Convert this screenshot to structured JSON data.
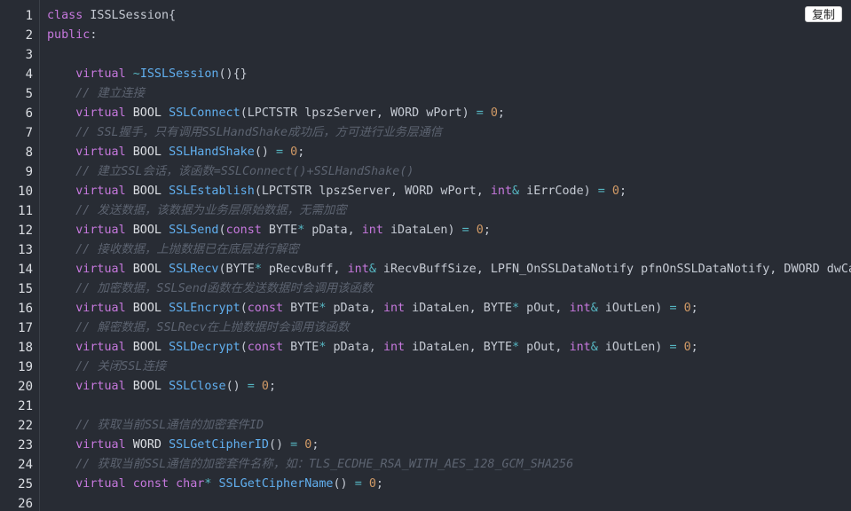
{
  "toolbar": {
    "copy_label": "复制"
  },
  "colors": {
    "background": "#282c34",
    "keyword": "#c678dd",
    "function": "#61afef",
    "number": "#d19a66",
    "operator": "#56b6c2",
    "comment": "#5c6370",
    "text": "#c5cad3"
  },
  "code": {
    "language": "cpp",
    "lines": [
      {
        "n": "1",
        "tokens": [
          [
            "kw",
            "class"
          ],
          [
            "pn",
            " ISSLSession{"
          ]
        ]
      },
      {
        "n": "2",
        "tokens": [
          [
            "kw",
            "public"
          ],
          [
            "pn",
            ":"
          ]
        ]
      },
      {
        "n": "3",
        "tokens": []
      },
      {
        "n": "4",
        "tokens": [
          [
            "pn",
            "    "
          ],
          [
            "kw",
            "virtual"
          ],
          [
            "pn",
            " "
          ],
          [
            "op",
            "~"
          ],
          [
            "fn",
            "ISSLSession"
          ],
          [
            "pn",
            "(){}"
          ]
        ]
      },
      {
        "n": "5",
        "tokens": [
          [
            "pn",
            "    "
          ],
          [
            "cm",
            "// 建立连接"
          ]
        ]
      },
      {
        "n": "6",
        "tokens": [
          [
            "pn",
            "    "
          ],
          [
            "kw",
            "virtual"
          ],
          [
            "ty",
            " BOOL "
          ],
          [
            "fn",
            "SSLConnect"
          ],
          [
            "pn",
            "(LPCTSTR lpszServer, WORD wPort) "
          ],
          [
            "op",
            "="
          ],
          [
            "pn",
            " "
          ],
          [
            "nm",
            "0"
          ],
          [
            "pn",
            ";"
          ]
        ]
      },
      {
        "n": "7",
        "tokens": [
          [
            "pn",
            "    "
          ],
          [
            "cm",
            "// SSL握手，只有调用SSLHandShake成功后，方可进行业务层通信"
          ]
        ]
      },
      {
        "n": "8",
        "tokens": [
          [
            "pn",
            "    "
          ],
          [
            "kw",
            "virtual"
          ],
          [
            "ty",
            " BOOL "
          ],
          [
            "fn",
            "SSLHandShake"
          ],
          [
            "pn",
            "() "
          ],
          [
            "op",
            "="
          ],
          [
            "pn",
            " "
          ],
          [
            "nm",
            "0"
          ],
          [
            "pn",
            ";"
          ]
        ]
      },
      {
        "n": "9",
        "tokens": [
          [
            "pn",
            "    "
          ],
          [
            "cm",
            "// 建立SSL会话，该函数=SSLConnect()+SSLHandShake()"
          ]
        ]
      },
      {
        "n": "10",
        "tokens": [
          [
            "pn",
            "    "
          ],
          [
            "kw",
            "virtual"
          ],
          [
            "ty",
            " BOOL "
          ],
          [
            "fn",
            "SSLEstablish"
          ],
          [
            "pn",
            "(LPCTSTR lpszServer, WORD wPort, "
          ],
          [
            "kw",
            "int"
          ],
          [
            "op",
            "&"
          ],
          [
            "pn",
            " iErrCode) "
          ],
          [
            "op",
            "="
          ],
          [
            "pn",
            " "
          ],
          [
            "nm",
            "0"
          ],
          [
            "pn",
            ";"
          ]
        ]
      },
      {
        "n": "11",
        "tokens": [
          [
            "pn",
            "    "
          ],
          [
            "cm",
            "// 发送数据，该数据为业务层原始数据，无需加密"
          ]
        ]
      },
      {
        "n": "12",
        "tokens": [
          [
            "pn",
            "    "
          ],
          [
            "kw",
            "virtual"
          ],
          [
            "ty",
            " BOOL "
          ],
          [
            "fn",
            "SSLSend"
          ],
          [
            "pn",
            "("
          ],
          [
            "kw",
            "const"
          ],
          [
            "pn",
            " BYTE"
          ],
          [
            "op",
            "*"
          ],
          [
            "pn",
            " pData, "
          ],
          [
            "kw",
            "int"
          ],
          [
            "pn",
            " iDataLen) "
          ],
          [
            "op",
            "="
          ],
          [
            "pn",
            " "
          ],
          [
            "nm",
            "0"
          ],
          [
            "pn",
            ";"
          ]
        ]
      },
      {
        "n": "13",
        "tokens": [
          [
            "pn",
            "    "
          ],
          [
            "cm",
            "// 接收数据，上抛数据已在底层进行解密"
          ]
        ]
      },
      {
        "n": "14",
        "tokens": [
          [
            "pn",
            "    "
          ],
          [
            "kw",
            "virtual"
          ],
          [
            "ty",
            " BOOL "
          ],
          [
            "fn",
            "SSLRecv"
          ],
          [
            "pn",
            "(BYTE"
          ],
          [
            "op",
            "*"
          ],
          [
            "pn",
            " pRecvBuff, "
          ],
          [
            "kw",
            "int"
          ],
          [
            "op",
            "&"
          ],
          [
            "pn",
            " iRecvBuffSize, LPFN_OnSSLDataNotify pfnOnSSLDataNotify, DWORD dwCallB"
          ]
        ]
      },
      {
        "n": "15",
        "tokens": [
          [
            "pn",
            "    "
          ],
          [
            "cm",
            "// 加密数据，SSLSend函数在发送数据时会调用该函数"
          ]
        ]
      },
      {
        "n": "16",
        "tokens": [
          [
            "pn",
            "    "
          ],
          [
            "kw",
            "virtual"
          ],
          [
            "ty",
            " BOOL "
          ],
          [
            "fn",
            "SSLEncrypt"
          ],
          [
            "pn",
            "("
          ],
          [
            "kw",
            "const"
          ],
          [
            "pn",
            " BYTE"
          ],
          [
            "op",
            "*"
          ],
          [
            "pn",
            " pData, "
          ],
          [
            "kw",
            "int"
          ],
          [
            "pn",
            " iDataLen, BYTE"
          ],
          [
            "op",
            "*"
          ],
          [
            "pn",
            " pOut, "
          ],
          [
            "kw",
            "int"
          ],
          [
            "op",
            "&"
          ],
          [
            "pn",
            " iOutLen) "
          ],
          [
            "op",
            "="
          ],
          [
            "pn",
            " "
          ],
          [
            "nm",
            "0"
          ],
          [
            "pn",
            ";"
          ]
        ]
      },
      {
        "n": "17",
        "tokens": [
          [
            "pn",
            "    "
          ],
          [
            "cm",
            "// 解密数据，SSLRecv在上抛数据时会调用该函数"
          ]
        ]
      },
      {
        "n": "18",
        "tokens": [
          [
            "pn",
            "    "
          ],
          [
            "kw",
            "virtual"
          ],
          [
            "ty",
            " BOOL "
          ],
          [
            "fn",
            "SSLDecrypt"
          ],
          [
            "pn",
            "("
          ],
          [
            "kw",
            "const"
          ],
          [
            "pn",
            " BYTE"
          ],
          [
            "op",
            "*"
          ],
          [
            "pn",
            " pData, "
          ],
          [
            "kw",
            "int"
          ],
          [
            "pn",
            " iDataLen, BYTE"
          ],
          [
            "op",
            "*"
          ],
          [
            "pn",
            " pOut, "
          ],
          [
            "kw",
            "int"
          ],
          [
            "op",
            "&"
          ],
          [
            "pn",
            " iOutLen) "
          ],
          [
            "op",
            "="
          ],
          [
            "pn",
            " "
          ],
          [
            "nm",
            "0"
          ],
          [
            "pn",
            ";"
          ]
        ]
      },
      {
        "n": "19",
        "tokens": [
          [
            "pn",
            "    "
          ],
          [
            "cm",
            "// 关闭SSL连接"
          ]
        ]
      },
      {
        "n": "20",
        "tokens": [
          [
            "pn",
            "    "
          ],
          [
            "kw",
            "virtual"
          ],
          [
            "ty",
            " BOOL "
          ],
          [
            "fn",
            "SSLClose"
          ],
          [
            "pn",
            "() "
          ],
          [
            "op",
            "="
          ],
          [
            "pn",
            " "
          ],
          [
            "nm",
            "0"
          ],
          [
            "pn",
            ";"
          ]
        ]
      },
      {
        "n": "21",
        "tokens": []
      },
      {
        "n": "22",
        "tokens": [
          [
            "pn",
            "    "
          ],
          [
            "cm",
            "// 获取当前SSL通信的加密套件ID"
          ]
        ]
      },
      {
        "n": "23",
        "tokens": [
          [
            "pn",
            "    "
          ],
          [
            "kw",
            "virtual"
          ],
          [
            "ty",
            " WORD "
          ],
          [
            "fn",
            "SSLGetCipherID"
          ],
          [
            "pn",
            "() "
          ],
          [
            "op",
            "="
          ],
          [
            "pn",
            " "
          ],
          [
            "nm",
            "0"
          ],
          [
            "pn",
            ";"
          ]
        ]
      },
      {
        "n": "24",
        "tokens": [
          [
            "pn",
            "    "
          ],
          [
            "cm",
            "// 获取当前SSL通信的加密套件名称，如：TLS_ECDHE_RSA_WITH_AES_128_GCM_SHA256"
          ]
        ]
      },
      {
        "n": "25",
        "tokens": [
          [
            "pn",
            "    "
          ],
          [
            "kw",
            "virtual"
          ],
          [
            "pn",
            " "
          ],
          [
            "kw",
            "const"
          ],
          [
            "pn",
            " "
          ],
          [
            "kw",
            "char"
          ],
          [
            "op",
            "*"
          ],
          [
            "pn",
            " "
          ],
          [
            "fn",
            "SSLGetCipherName"
          ],
          [
            "pn",
            "() "
          ],
          [
            "op",
            "="
          ],
          [
            "pn",
            " "
          ],
          [
            "nm",
            "0"
          ],
          [
            "pn",
            ";"
          ]
        ]
      },
      {
        "n": "26",
        "tokens": []
      }
    ]
  }
}
